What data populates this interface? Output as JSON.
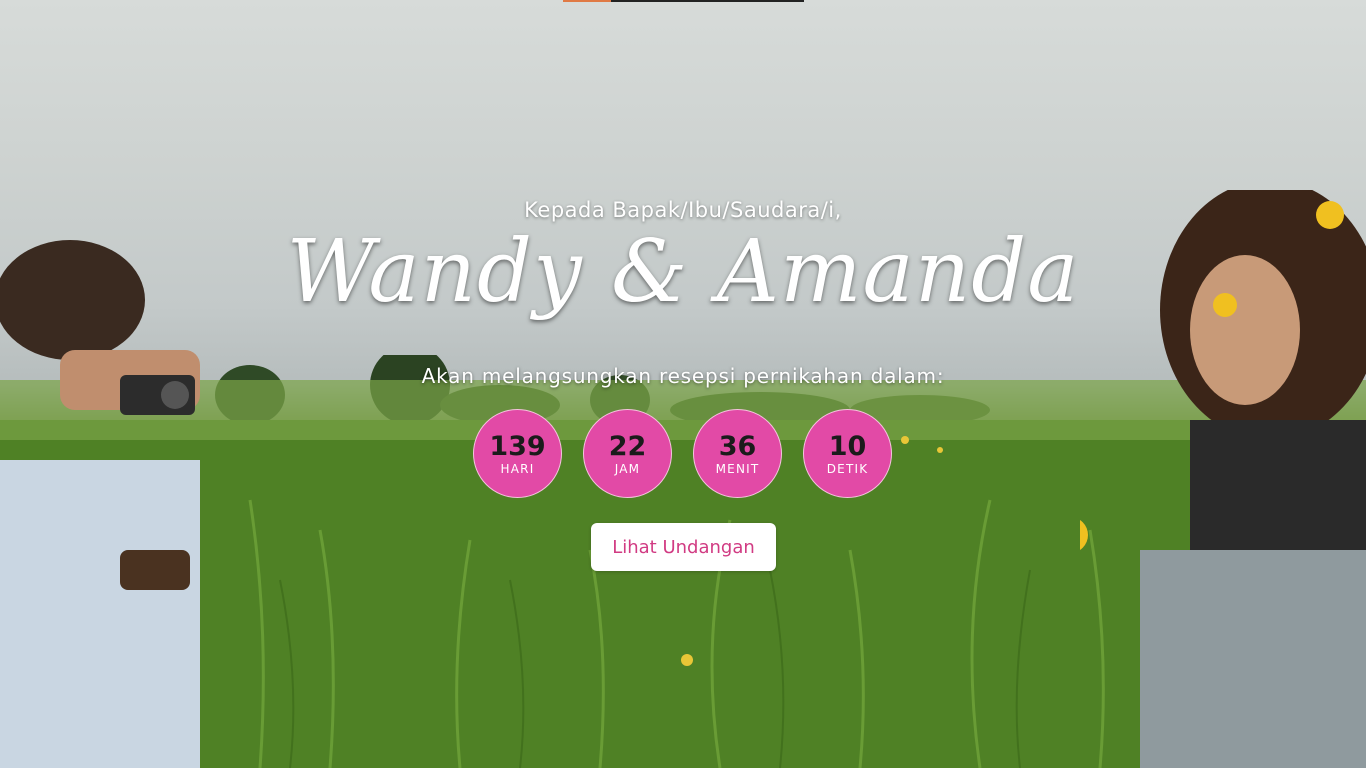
{
  "greeting": "Kepada Bapak/Ibu/Saudara/i,",
  "couple_names": "Wandy & Amanda",
  "subtitle": "Akan melangsungkan resepsi pernikahan dalam:",
  "countdown": [
    {
      "value": "139",
      "unit": "HARI"
    },
    {
      "value": "22",
      "unit": "JAM"
    },
    {
      "value": "36",
      "unit": "MENIT"
    },
    {
      "value": "10",
      "unit": "DETIK"
    }
  ],
  "cta_label": "Lihat Undangan",
  "colors": {
    "circle_fill": "#e24aa6",
    "button_text": "#d13b83",
    "accent_bar": "#e07a45"
  }
}
